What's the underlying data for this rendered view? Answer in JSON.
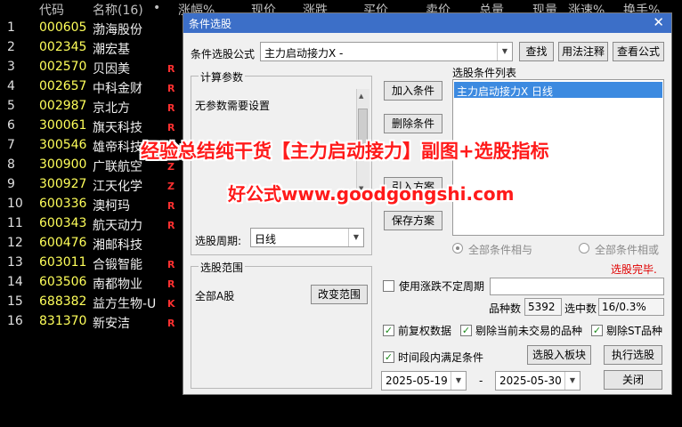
{
  "list_header": {
    "code": "代码",
    "name": "名称(16)",
    "dot": "•",
    "change_pct": "涨幅%",
    "price": "现价",
    "change": "涨跌",
    "bid": "买价",
    "ask": "卖价",
    "volume": "总量",
    "current_vol": "现量",
    "speed": "涨速%",
    "turnover": "换手%"
  },
  "stocks": [
    {
      "idx": "1",
      "code": "000605",
      "name": "渤海股份",
      "flag": ""
    },
    {
      "idx": "2",
      "code": "002345",
      "name": "潮宏基",
      "flag": ""
    },
    {
      "idx": "3",
      "code": "002570",
      "name": "贝因美",
      "flag": "R"
    },
    {
      "idx": "4",
      "code": "002657",
      "name": "中科金财",
      "flag": "R"
    },
    {
      "idx": "5",
      "code": "002987",
      "name": "京北方",
      "flag": "R"
    },
    {
      "idx": "6",
      "code": "300061",
      "name": "旗天科技",
      "flag": "R"
    },
    {
      "idx": "7",
      "code": "300546",
      "name": "雄帝科技",
      "flag": ""
    },
    {
      "idx": "8",
      "code": "300900",
      "name": "广联航空",
      "flag": "Z"
    },
    {
      "idx": "9",
      "code": "300927",
      "name": "江天化学",
      "flag": "Z"
    },
    {
      "idx": "10",
      "code": "600336",
      "name": "澳柯玛",
      "flag": "R"
    },
    {
      "idx": "11",
      "code": "600343",
      "name": "航天动力",
      "flag": "R"
    },
    {
      "idx": "12",
      "code": "600476",
      "name": "湘邮科技",
      "flag": ""
    },
    {
      "idx": "13",
      "code": "603011",
      "name": "合锻智能",
      "flag": "R"
    },
    {
      "idx": "14",
      "code": "603506",
      "name": "南都物业",
      "flag": "R"
    },
    {
      "idx": "15",
      "code": "688382",
      "name": "益方生物-U",
      "flag": "K"
    },
    {
      "idx": "16",
      "code": "831370",
      "name": "新安洁",
      "flag": "R"
    }
  ],
  "dialog": {
    "title": "条件选股",
    "close": "✕",
    "formula_label": "条件选股公式",
    "formula_value": "主力启动接力X -",
    "btn_find": "查找",
    "btn_usage": "用法注释",
    "btn_view": "查看公式",
    "params_group": "计算参数",
    "params_text": "无参数需要设置",
    "btn_add": "加入条件",
    "btn_delete": "删除条件",
    "btn_import": "引入方案",
    "btn_save": "保存方案",
    "cond_list_label": "选股条件列表",
    "cond_item": "主力启动接力X  日线",
    "period_label": "选股周期:",
    "period_value": "日线",
    "radio_and": "全部条件相与",
    "radio_or": "全部条件相或",
    "status": "选股完毕.",
    "range_group": "选股范围",
    "range_value": "全部A股",
    "btn_change_range": "改变范围",
    "use_period_label": "使用涨跌不定周期",
    "count_label": "品种数",
    "count_value": "5392",
    "selected_label": "选中数",
    "selected_value": "16/0.3%",
    "chk_fq": "前复权数据",
    "chk_exclude_untraded": "剔除当前未交易的品种",
    "chk_exclude_st": "剔除ST品种",
    "chk_interval": "时间段内满足条件",
    "btn_to_block": "选股入板块",
    "btn_run": "执行选股",
    "date_start": "2025-05-19",
    "date_sep": "-",
    "date_end": "2025-05-30",
    "btn_close": "关闭"
  },
  "watermark": {
    "line1": "经验总结纯干货【主力启动接力】副图+选股指标",
    "line2": "好公式www.goodgongshi.com"
  }
}
